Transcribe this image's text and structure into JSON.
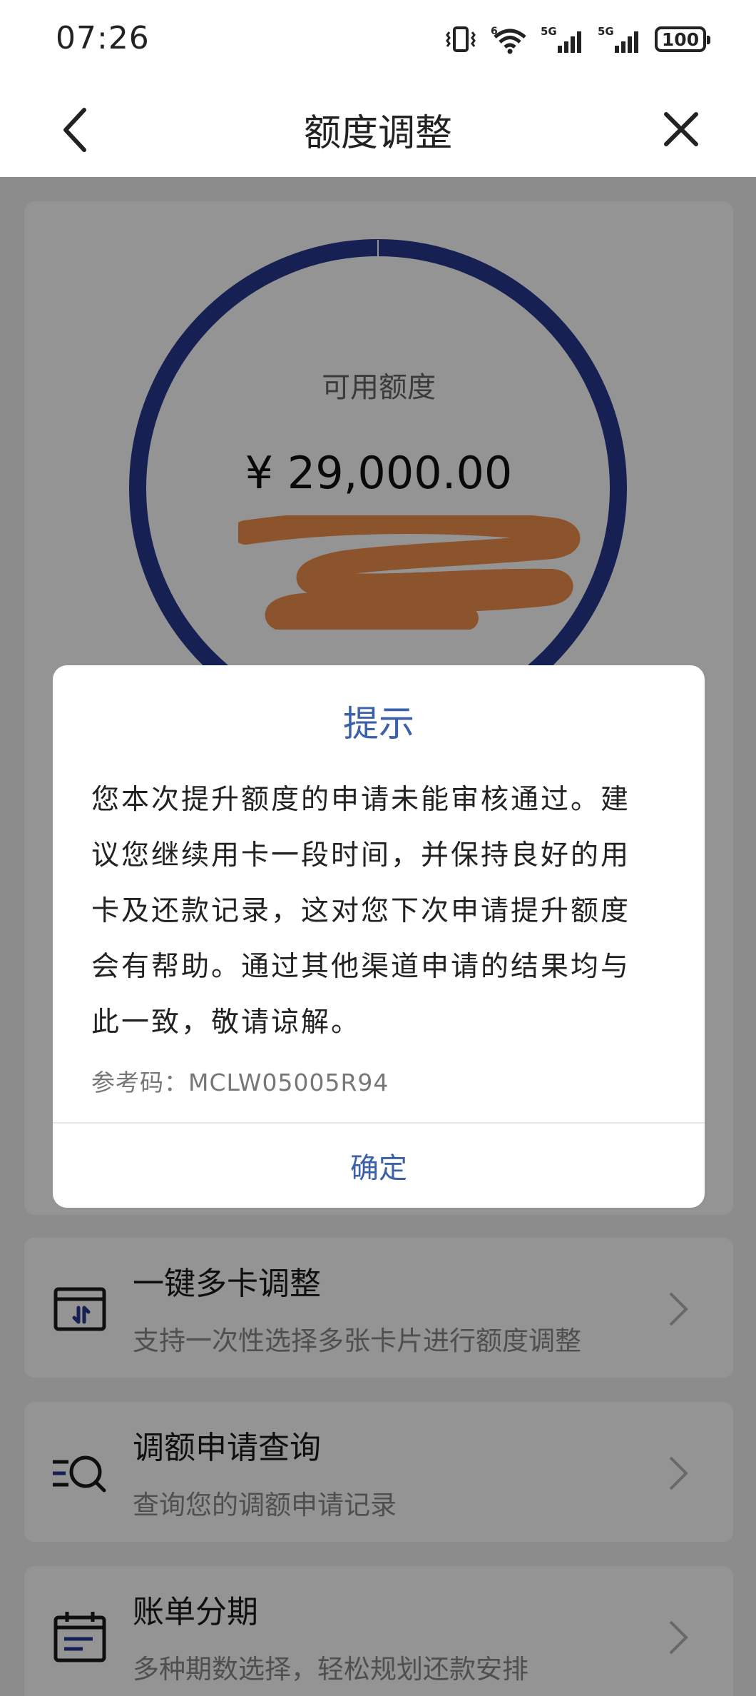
{
  "status_bar": {
    "time": "07:26",
    "network_1": "5G",
    "network_2": "5G",
    "wifi_label": "6",
    "battery": "100",
    "icons": [
      "vibrate-icon",
      "wifi-icon",
      "signal-icon",
      "signal-icon",
      "battery-icon"
    ]
  },
  "nav": {
    "title": "额度调整",
    "back_icon": "chevron-left-icon",
    "close_icon": "close-icon"
  },
  "limit_card": {
    "label": "可用额度",
    "amount": "¥ 29,000.00",
    "ring_color": "#27378f",
    "redaction_color": "#f0914d"
  },
  "features": [
    {
      "title": "一键多卡调整",
      "subtitle": "支持一次性选择多张卡片进行额度调整",
      "icon": "multi-card-adjust-icon"
    },
    {
      "title": "调额申请查询",
      "subtitle": "查询您的调额申请记录",
      "icon": "search-records-icon"
    },
    {
      "title": "账单分期",
      "subtitle": "多种期数选择，轻松规划还款安排",
      "icon": "calendar-installment-icon"
    }
  ],
  "dialog": {
    "title": "提示",
    "lines": [
      "您本次提升额度的申请未能审核通过。建",
      "议您继续用卡一段时间，并保持良好的用",
      "卡及还款记录，这对您下次申请提升额度",
      "会有帮助。通过其他渠道申请的结果均与",
      "此一致，敬请谅解。"
    ],
    "reference": "参考码：MCLW05005R94",
    "confirm_label": "确定",
    "accent_color": "#3b62a8"
  }
}
